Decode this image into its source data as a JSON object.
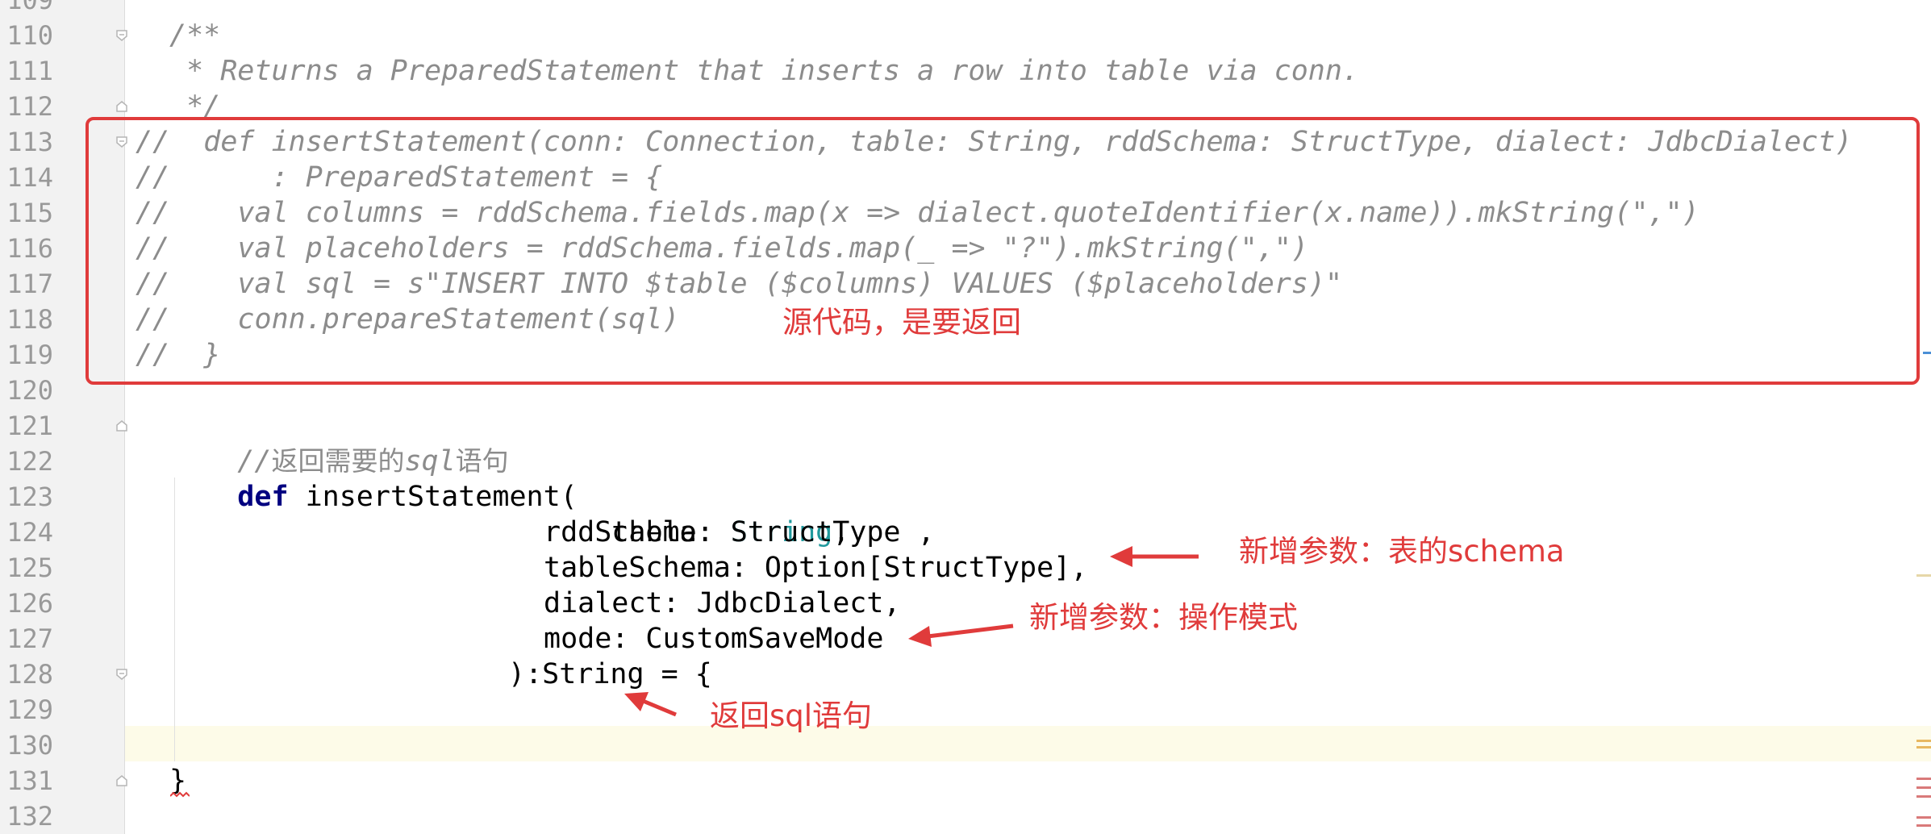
{
  "editor": {
    "line_numbers": [
      "109",
      "110",
      "111",
      "112",
      "113",
      "114",
      "115",
      "116",
      "117",
      "118",
      "119",
      "120",
      "121",
      "122",
      "123",
      "124",
      "125",
      "126",
      "127",
      "128",
      "129",
      "130",
      "131",
      "132"
    ],
    "lines": {
      "l110": "/**",
      "l111": " * Returns a PreparedStatement that inserts a row into table via conn.",
      "l112": " */",
      "l113": "//  def insertStatement(conn: Connection, table: String, rddSchema: StructType, dialect: JdbcDialect)",
      "l114": "//      : PreparedStatement = {",
      "l115": "//    val columns = rddSchema.fields.map(x => dialect.quoteIdentifier(x.name)).mkString(\",\")",
      "l116": "//    val placeholders = rddSchema.fields.map(_ => \"?\").mkString(\",\")",
      "l117": "//    val sql = s\"INSERT INTO $table ($columns) VALUES ($placeholders)\"",
      "l118": "//    conn.prepareStatement(sql)",
      "l119": "//  }",
      "l121_prefix": "//",
      "l121_zh1": "返回需要的",
      "l121_sql": "sql",
      "l121_zh2": "语句",
      "l122_kw": "def",
      "l122_rest": " insertStatement(",
      "l123_name": "table: ",
      "l123_type": "String",
      "l123_end": ",",
      "l124": "rddSchema: StructType ,",
      "l125": "tableSchema: Option[StructType],",
      "l126": "dialect: JdbcDialect,",
      "l127": "mode: CustomSaveMode",
      "l128": "):String = {",
      "l131": "}"
    }
  },
  "annotations": {
    "source_code": "源代码，是要返回",
    "new_param_schema": "新增参数：表的schema",
    "new_param_mode": "新增参数：操作模式",
    "return_sql": "返回sql语句"
  },
  "colors": {
    "annotation_red": "#e03b3b",
    "comment_gray": "#8c8c8c",
    "keyword_navy": "#000080",
    "type_teal": "#20999d",
    "current_line": "#fdfbe8"
  }
}
